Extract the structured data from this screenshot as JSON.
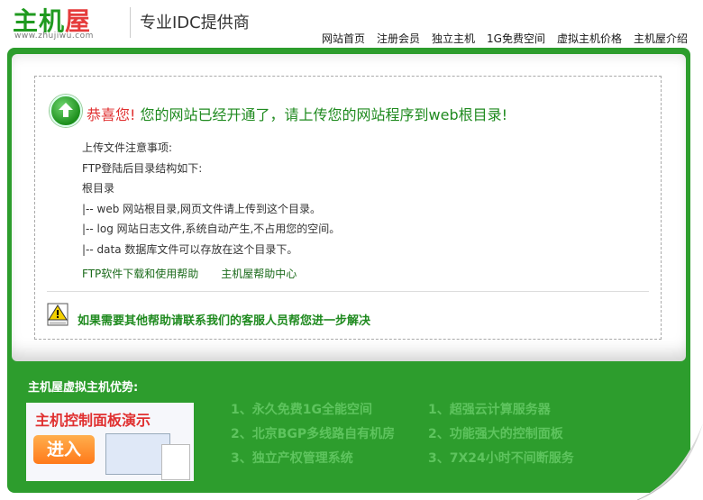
{
  "header": {
    "logo_text_1": "主机",
    "logo_text_2": "屋",
    "logo_url": "www.zhujiwu.com",
    "slogan": "专业IDC提供商",
    "nav": [
      "网站首页",
      "注册会员",
      "独立主机",
      "1G免费空间",
      "虚拟主机价格",
      "主机屋介绍"
    ]
  },
  "main": {
    "greeting": "恭喜您!",
    "headline": " 您的网站已经开通了，请上传您的网站程序到web根目录!",
    "notes": [
      "上传文件注意事项:",
      "FTP登陆后目录结构如下:",
      "根目录",
      "|-- web 网站根目录,网页文件请上传到这个目录。",
      "|-- log 网站日志文件,系统自动产生,不占用您的空间。",
      "|-- data 数据库文件可以存放在这个目录下。"
    ],
    "links": [
      "FTP软件下载和使用帮助",
      "主机屋帮助中心"
    ],
    "help_text": "如果需要其他帮助请联系我们的客服人员帮您进一步解决"
  },
  "footer": {
    "advantages_title": "主机屋虚拟主机优势:",
    "demo_title": "主机控制面板演示",
    "demo_button": "进入",
    "features_left": [
      "1、永久免费1G全能空间",
      "2、北京BGP多线路自有机房",
      "3、独立产权管理系统"
    ],
    "features_right": [
      "1、超强云计算服务器",
      "2、功能强大的控制面板",
      "3、7X24小时不间断服务"
    ]
  },
  "colors": {
    "brand_green": "#2d9d2d",
    "accent_red": "#e03030"
  }
}
